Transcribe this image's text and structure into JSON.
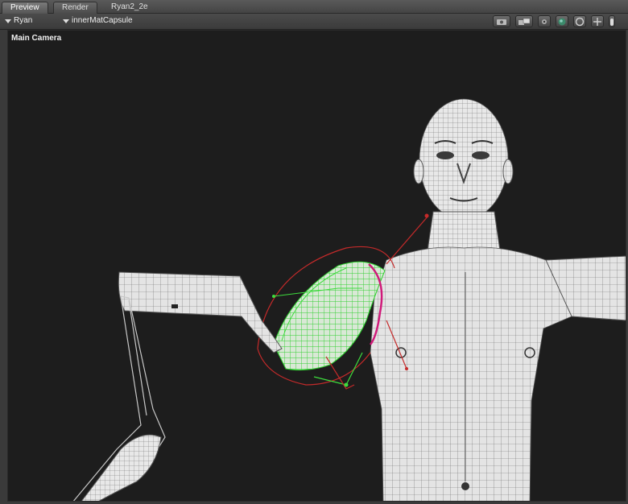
{
  "tabs": [
    {
      "label": "Preview",
      "active": true
    },
    {
      "label": "Render",
      "active": false
    }
  ],
  "document_title": "Ryan2_2e",
  "toolbar": {
    "figure_select": "Ryan",
    "material_select": "innerMatCapsule",
    "icons": [
      "camera-icon",
      "dual-view-icon",
      "light-icon",
      "texture-shaded-icon",
      "sphere-icon",
      "translate-icon",
      "lock-icon"
    ]
  },
  "viewport": {
    "camera_label": "Main Camera",
    "background": "#1d1d1d"
  },
  "colors": {
    "mesh": "#d8d8d8",
    "selection_green": "#3ddc3d",
    "influence_red": "#c42a2a",
    "magenta": "#d01a7a"
  }
}
